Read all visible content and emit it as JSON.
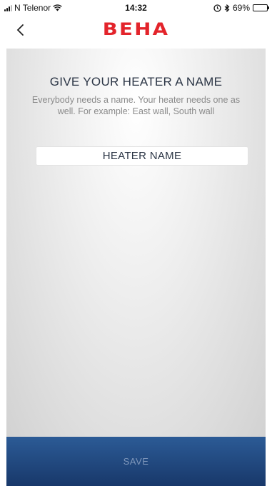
{
  "status_bar": {
    "carrier": "N Telenor",
    "time": "14:32",
    "battery_percent": "69%",
    "icons": [
      "signal-icon",
      "wifi-icon",
      "alarm-icon",
      "bluetooth-icon",
      "battery-icon"
    ]
  },
  "nav": {
    "back_icon": "chevron-left-icon",
    "logo_text": "BEHA"
  },
  "main": {
    "title": "GIVE YOUR HEATER A NAME",
    "subtitle": "Everybody needs a name. Your heater needs one as well. For example: East wall, South wall",
    "name_field": {
      "placeholder": "HEATER NAME",
      "value": ""
    }
  },
  "footer": {
    "save_label": "SAVE"
  },
  "colors": {
    "brand_red": "#e3242b",
    "save_bar": "#214a82",
    "title_text": "#2b3545"
  }
}
